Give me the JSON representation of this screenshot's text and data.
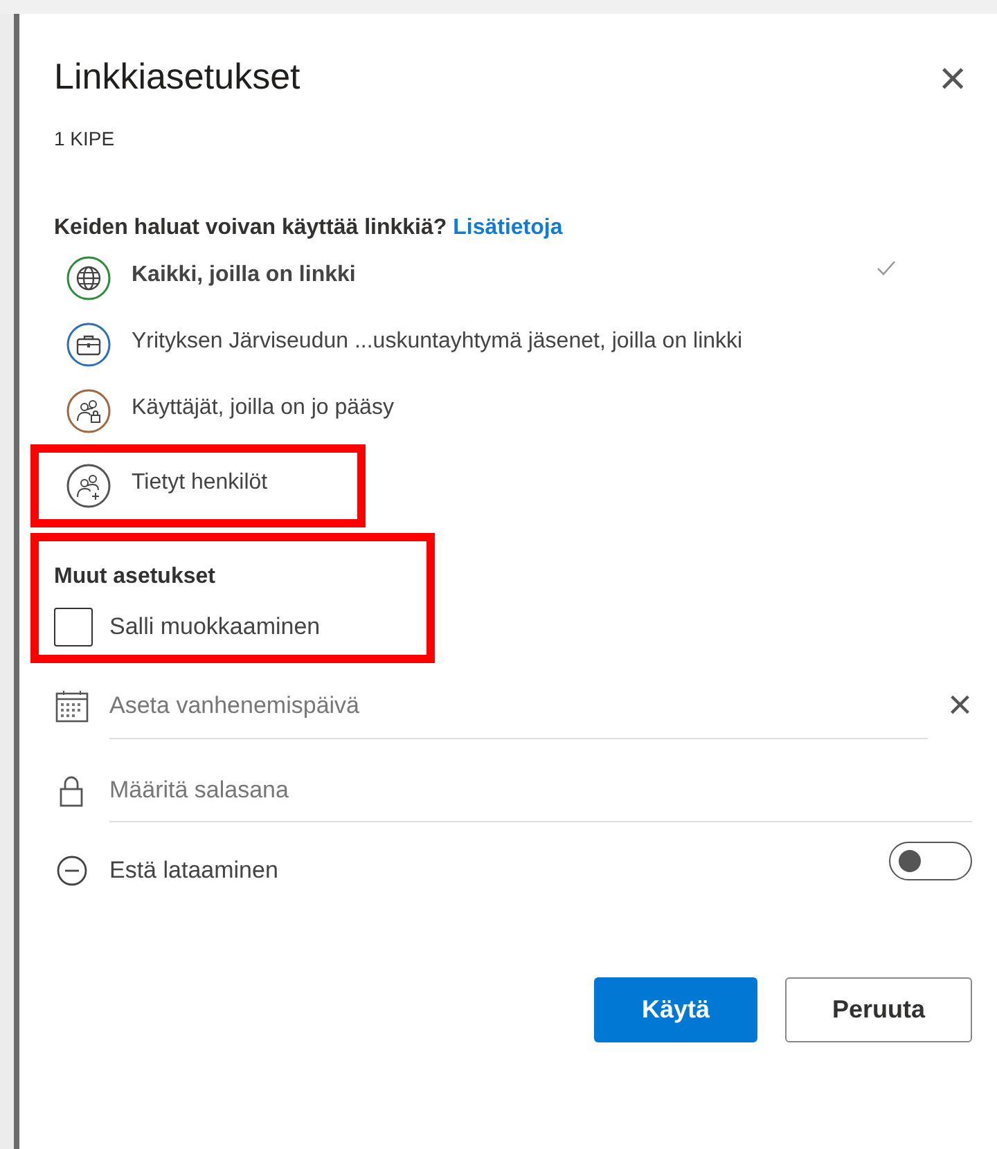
{
  "dialog": {
    "title": "Linkkiasetukset",
    "subtitle": "1 KIPE",
    "close_icon": "×",
    "question": {
      "text": "Keiden haluat voivan käyttää linkkiä?",
      "link": "Lisätietoja"
    },
    "options": [
      {
        "kind": "globe",
        "label": "Kaikki, joilla on linkki",
        "selected": true,
        "color": "#2e8b3a",
        "highlighted": false
      },
      {
        "kind": "briefcase",
        "label": "Yrityksen Järviseudun ...uskuntayhtymä jäsenet, joilla on linkki",
        "selected": false,
        "color": "#2f6fb3",
        "highlighted": false
      },
      {
        "kind": "people-lock",
        "label": "Käyttäjät, joilla on jo pääsy",
        "selected": false,
        "color": "#a0683f",
        "highlighted": false
      },
      {
        "kind": "people-add",
        "label": "Tietyt henkilöt",
        "selected": false,
        "color": "#555555",
        "highlighted": true
      }
    ],
    "other_settings": {
      "heading": "Muut asetukset",
      "highlighted": true,
      "allow_editing": {
        "label": "Salli muokkaaminen",
        "checked": false
      }
    },
    "expiry": {
      "placeholder": "Aseta vanhenemispäivä",
      "clear_icon": "×"
    },
    "password": {
      "placeholder": "Määritä salasana"
    },
    "block_download": {
      "label": "Estä lataaminen",
      "on": false
    },
    "buttons": [
      {
        "kind": "primary",
        "label": "Käytä"
      },
      {
        "kind": "secondary",
        "label": "Peruuta"
      }
    ]
  }
}
